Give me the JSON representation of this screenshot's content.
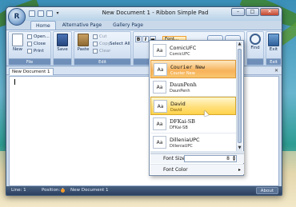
{
  "window": {
    "title": "New Document 1 - Ribbon Simple Pad",
    "orb_letter": "R",
    "controls": {
      "minimize": "–",
      "maximize": "□",
      "close": "✕"
    }
  },
  "ribbon": {
    "tabs": [
      "Home",
      "Alternative Page",
      "Gallery Page"
    ],
    "file": {
      "new": "New",
      "open": "Open...",
      "close": "Close",
      "print": "Print",
      "label": "File"
    },
    "save": {
      "save": "Save"
    },
    "edit": {
      "paste": "Paste",
      "cut": "Cut",
      "copy": "Copy",
      "clear": "Clear",
      "select_all": "Select All",
      "label": "Edit"
    },
    "format": {
      "bold": "B",
      "italic": "I",
      "font_value": "Font..."
    },
    "find": "Find",
    "exit": {
      "exit": "Exit",
      "label": "Exit"
    }
  },
  "document": {
    "tab_label": "New Document 1",
    "close_glyph": "✕"
  },
  "status": {
    "line": "Line: 1",
    "position": "Position: 1",
    "doc": "New Document 1",
    "about": "About"
  },
  "font_dropdown": {
    "swatch_text": "Aa",
    "items": [
      {
        "name": "ComicUFC",
        "sub": "ComicUFC",
        "state": "normal",
        "style": "sans"
      },
      {
        "name": "Courier New",
        "sub": "Courier New",
        "state": "hover",
        "style": "mono"
      },
      {
        "name": "DaunPenh",
        "sub": "DaunPenh",
        "state": "normal",
        "style": "serif"
      },
      {
        "name": "David",
        "sub": "David",
        "state": "selected",
        "style": "sans"
      },
      {
        "name": "DFKai-SB",
        "sub": "DFKai-SB",
        "state": "normal",
        "style": "serif"
      },
      {
        "name": "DilleniaUPC",
        "sub": "DilleniaUPC",
        "state": "normal",
        "style": "sans"
      }
    ],
    "font_size_label": "Font Size",
    "font_size_value": "8",
    "font_color_label": "Font Color",
    "font_color_arrow": "▸"
  }
}
